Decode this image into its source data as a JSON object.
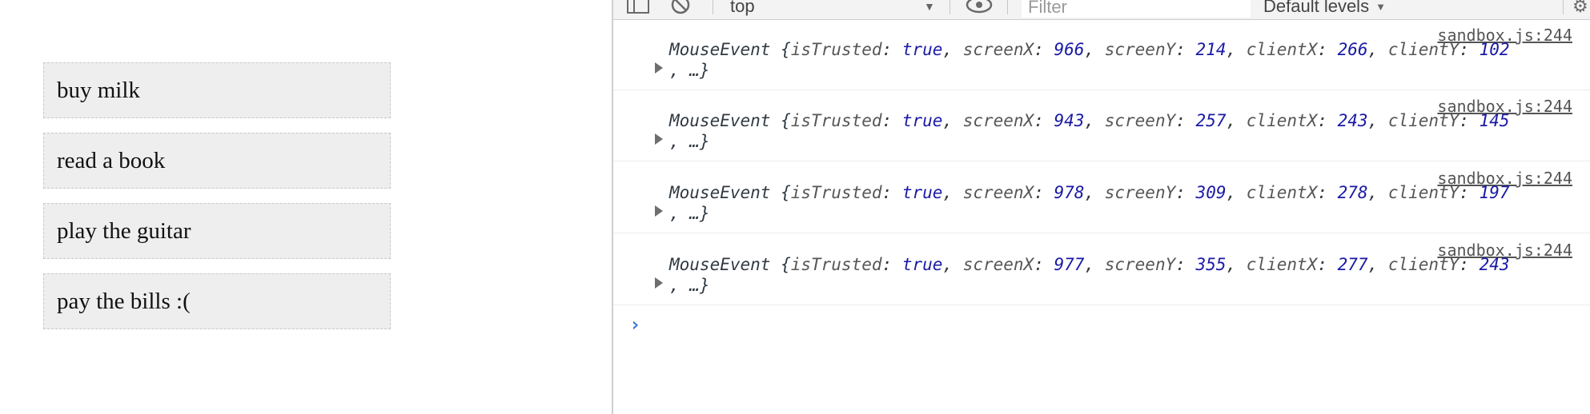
{
  "todos": [
    "buy milk",
    "read a book",
    "play the guitar",
    "pay the bills :("
  ],
  "toolbar": {
    "context": "top",
    "filter_placeholder": "Filter",
    "levels": "Default levels"
  },
  "console": {
    "source": "sandbox.js:244",
    "entries": [
      {
        "screenX": "966",
        "screenY": "214",
        "clientX": "266",
        "clientY": "102"
      },
      {
        "screenX": "943",
        "screenY": "257",
        "clientX": "243",
        "clientY": "145"
      },
      {
        "screenX": "978",
        "screenY": "309",
        "clientX": "278",
        "clientY": "197"
      },
      {
        "screenX": "977",
        "screenY": "355",
        "clientX": "277",
        "clientY": "243"
      }
    ],
    "prompt": "›"
  },
  "colors": {
    "keyword": "#1a1aa6",
    "prompt": "#3a7ad8",
    "item_bg": "#eeeeee"
  },
  "icons": [
    "sidebar-icon",
    "clear-console-icon",
    "dropdown-arrow-icon",
    "eye-icon",
    "gear-icon"
  ]
}
